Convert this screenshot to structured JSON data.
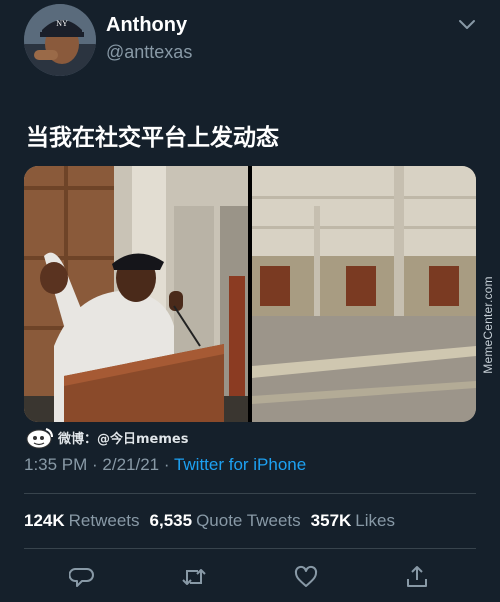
{
  "user": {
    "display_name": "Anthony",
    "handle": "@anttexas",
    "avatar_icon": "avatar-photo"
  },
  "tweet": {
    "text": "当我在社交平台上发动态"
  },
  "media": {
    "left_image": "man-speaking-at-podium",
    "right_image": "empty-convention-hall"
  },
  "watermarks": {
    "side": "MemeCenter.com",
    "weibo": "微博：@今日memes"
  },
  "meta": {
    "timestamp": "1:35 PM · 2/21/21 · ",
    "source": "Twitter for iPhone"
  },
  "stats": {
    "retweets_count": "124K",
    "retweets_label": "Retweets",
    "quotes_count": "6,535",
    "quotes_label": "Quote Tweets",
    "likes_count": "357K",
    "likes_label": "Likes"
  },
  "actions": [
    "reply-icon",
    "retweet-icon",
    "like-icon",
    "share-icon"
  ],
  "colors": {
    "background": "#15202b",
    "secondary_text": "#8899a6",
    "link": "#1da1f2",
    "divider": "#38444d"
  }
}
